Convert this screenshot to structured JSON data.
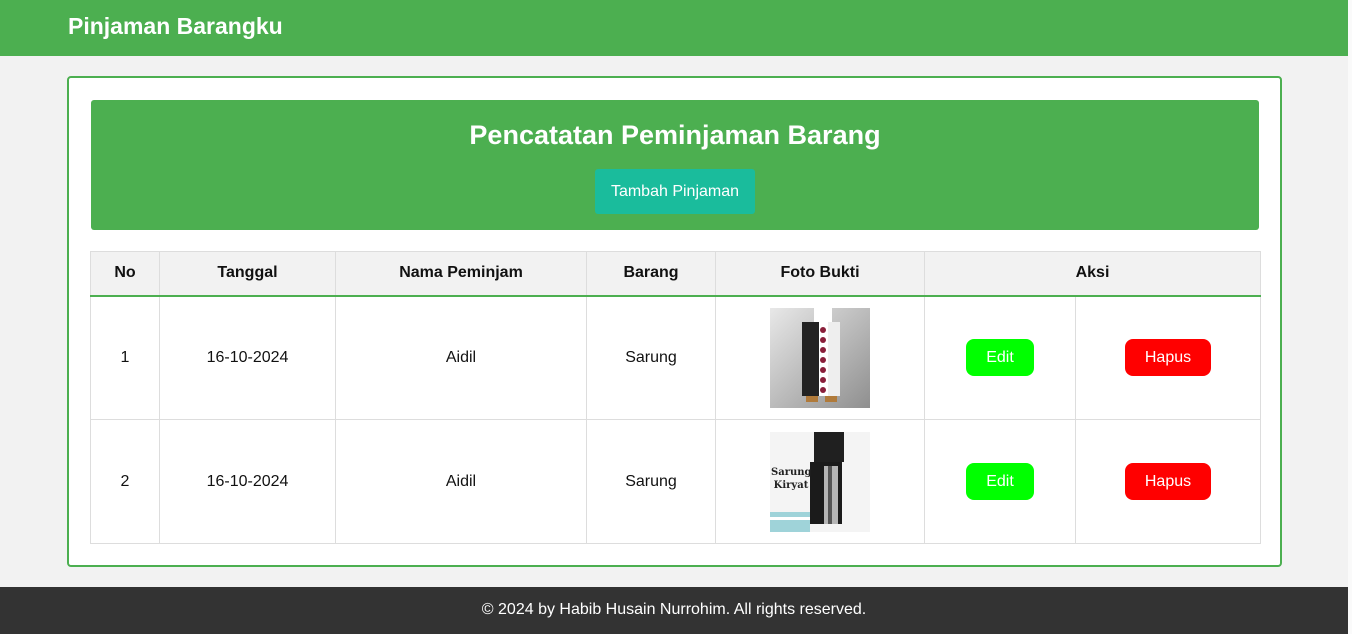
{
  "navbar": {
    "brand": "Pinjaman Barangku"
  },
  "hero": {
    "title": "Pencatatan Peminjaman Barang",
    "add_button": "Tambah Pinjaman"
  },
  "table": {
    "headers": [
      "No",
      "Tanggal",
      "Nama Peminjam",
      "Barang",
      "Foto Bukti",
      "Aksi"
    ],
    "rows": [
      {
        "no": "1",
        "tanggal": "16-10-2024",
        "nama": "Aidil",
        "barang": "Sarung",
        "photo_caption": "",
        "edit": "Edit",
        "hapus": "Hapus"
      },
      {
        "no": "2",
        "tanggal": "16-10-2024",
        "nama": "Aidil",
        "barang": "Sarung",
        "photo_caption": "Sarung Kiryat",
        "edit": "Edit",
        "hapus": "Hapus"
      }
    ]
  },
  "footer": {
    "text": "© 2024 by Habib Husain Nurrohim. All rights reserved."
  },
  "colors": {
    "primary": "#4caf50",
    "teal_button": "#1abc9c",
    "edit_button": "#00ff00",
    "delete_button": "#ff0000",
    "footer_bg": "#333333"
  }
}
